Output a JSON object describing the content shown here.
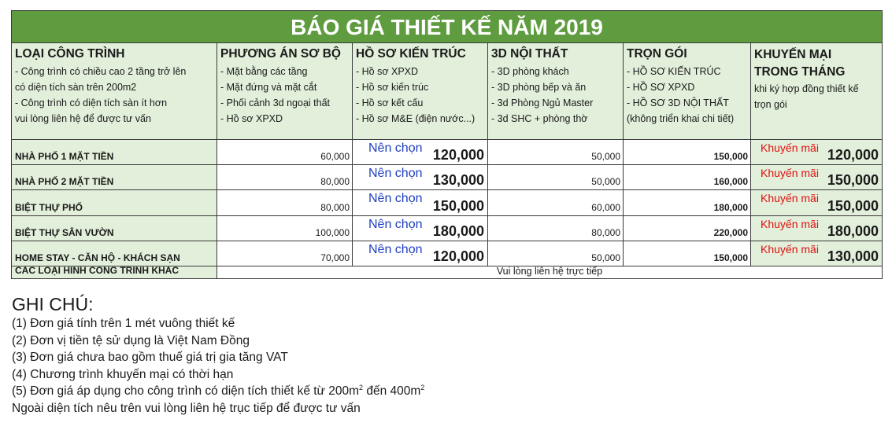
{
  "title": "BÁO GIÁ THIẾT KẾ NĂM 2019",
  "columns": [
    {
      "heading": "LOẠI CÔNG TRÌNH",
      "lines": [
        "- Công trình có chiều cao 2 tầng  trở lên",
        "có diện tích sàn trên 200m2",
        "- Công trình có diện tích sàn ít hơn",
        "vui lòng liên hệ để được tư vấn"
      ]
    },
    {
      "heading": "PHƯƠNG ÁN SƠ BỘ",
      "lines": [
        "- Mặt bằng các tầng",
        "- Mặt đứng và mặt cắt",
        "- Phối cảnh 3d ngoại thất",
        "- Hồ sơ XPXD"
      ]
    },
    {
      "heading": "HỒ SƠ KIẾN TRÚC",
      "lines": [
        "- Hồ sơ XPXD",
        "- Hồ sơ kiến trúc",
        "- Hồ sơ kết cấu",
        "- Hồ sơ M&E (điện nước...)"
      ]
    },
    {
      "heading": "3D NỘI THẤT",
      "lines": [
        "- 3D phòng khách",
        "- 3D phòng bếp và ăn",
        "- 3d Phòng Ngủ Master",
        "- 3d SHC + phòng thờ"
      ]
    },
    {
      "heading": "TRỌN GÓI",
      "lines": [
        "- HỒ SƠ KIẾN TRÚC",
        "- HỒ SƠ XPXD",
        "- HỒ SƠ 3D NỘI THẤT",
        "(không triển khai chi tiết)"
      ]
    },
    {
      "heading1": "KHUYẾN MẠI",
      "heading2": "TRONG THÁNG",
      "lines": [
        "khi ký hợp đồng thiết kế",
        "trọn gói"
      ]
    }
  ],
  "recommend_label": "Nên chọn",
  "promo_label": "Khuyến mãi",
  "rows": [
    {
      "type": "NHÀ PHỐ 1 MẶT TIỀN",
      "so_bo": "60,000",
      "kien_truc": "120,000",
      "noi_that": "50,000",
      "tron_goi": "150,000",
      "khuyen_mai": "120,000"
    },
    {
      "type": "NHÀ PHỐ 2 MẶT TIỀN",
      "so_bo": "80,000",
      "kien_truc": "130,000",
      "noi_that": "50,000",
      "tron_goi": "160,000",
      "khuyen_mai": "150,000"
    },
    {
      "type": "BIỆT THỰ PHỐ",
      "so_bo": "80,000",
      "kien_truc": "150,000",
      "noi_that": "60,000",
      "tron_goi": "180,000",
      "khuyen_mai": "150,000"
    },
    {
      "type": "BIỆT THỰ SÂN VƯỜN",
      "so_bo": "100,000",
      "kien_truc": "180,000",
      "noi_that": "80,000",
      "tron_goi": "220,000",
      "khuyen_mai": "180,000"
    },
    {
      "type": "HOME STAY - CĂN HỘ - KHÁCH SẠN",
      "so_bo": "70,000",
      "kien_truc": "120,000",
      "noi_that": "50,000",
      "tron_goi": "150,000",
      "khuyen_mai": "130,000"
    }
  ],
  "other": {
    "label": "CÁC LOẠI HÌNH CÔNG TRÌNH KHÁC",
    "note": "Vui lòng liên hệ trực tiếp"
  },
  "notes": {
    "heading": "GHI CHÚ:",
    "n1": "(1) Đơn giá tính trên 1 mét vuông thiết kế",
    "n2": "(2) Đơn vị tiền tệ sử dụng là Việt Nam Đồng",
    "n3": "(3) Đơn giá chưa bao gồm thuế giá trị gia tăng VAT",
    "n4": "(4) Chương trình khuyến mại có thời hạn",
    "n5_a": "(5) Đơn giá áp dụng cho công trình có diện tích thiết kế từ 200m",
    "n5_sup1": "2",
    "n5_b": " đến 400m",
    "n5_sup2": "2",
    "n6": "Ngoài diện tích nêu trên vui lòng liên hệ trục tiếp để được tư vấn"
  },
  "colors": {
    "header_green": "#5e9c3f",
    "light_green": "#e2efda",
    "recommend_blue": "#1f3fbf",
    "promo_red": "#e01010"
  }
}
